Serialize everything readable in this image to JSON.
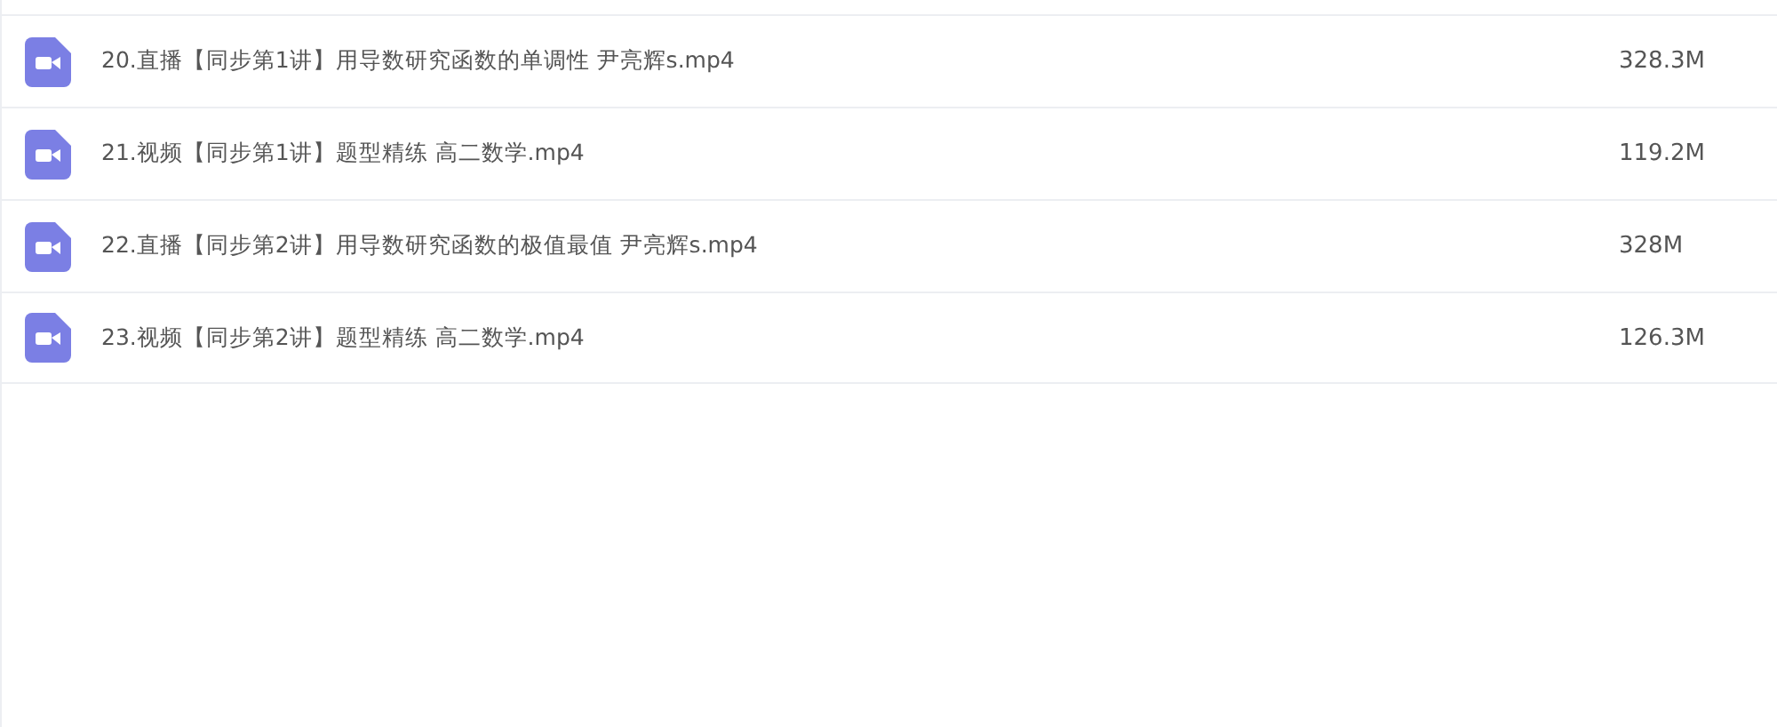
{
  "files": [
    {
      "name": "20.直播【同步第1讲】用导数研究函数的单调性 尹亮辉s.mp4",
      "size": "328.3M"
    },
    {
      "name": "21.视频【同步第1讲】题型精练 高二数学.mp4",
      "size": "119.2M"
    },
    {
      "name": "22.直播【同步第2讲】用导数研究函数的极值最值 尹亮辉s.mp4",
      "size": "328M"
    },
    {
      "name": "23.视频【同步第2讲】题型精练 高二数学.mp4",
      "size": "126.3M"
    }
  ]
}
